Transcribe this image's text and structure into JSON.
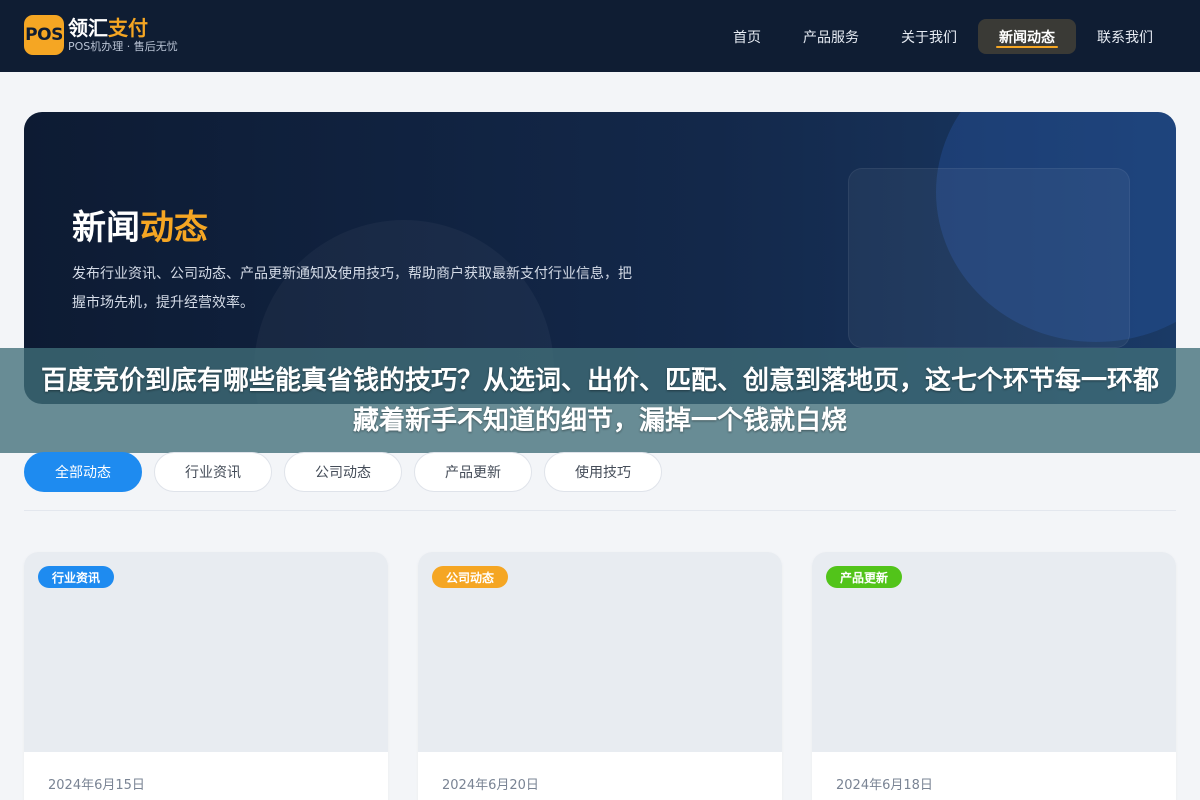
{
  "header": {
    "logo_badge": "POS",
    "logo_name_part1": "领汇",
    "logo_name_part2": "支付",
    "logo_sub": "POS机办理 · 售后无忧",
    "nav": [
      {
        "label": "首页",
        "active": false
      },
      {
        "label": "产品服务",
        "active": false
      },
      {
        "label": "关于我们",
        "active": false
      },
      {
        "label": "新闻动态",
        "active": true
      },
      {
        "label": "联系我们",
        "active": false
      }
    ]
  },
  "hero": {
    "title_part1": "新闻",
    "title_part2": "动态",
    "description": "发布行业资讯、公司动态、产品更新通知及使用技巧，帮助商户获取最新支付行业信息，把握市场先机，提升经营效率。"
  },
  "overlay": {
    "text": "百度竞价到底有哪些能真省钱的技巧？从选词、出价、匹配、创意到落地页，这七个环节每一环都藏着新手不知道的细节，漏掉一个钱就白烧"
  },
  "tabs": [
    {
      "label": "全部动态",
      "active": true
    },
    {
      "label": "行业资讯",
      "active": false
    },
    {
      "label": "公司动态",
      "active": false
    },
    {
      "label": "产品更新",
      "active": false
    },
    {
      "label": "使用技巧",
      "active": false
    }
  ],
  "cards": [
    {
      "badge": "行业资讯",
      "badge_color": "#1e8bf0",
      "date": "2024年6月15日"
    },
    {
      "badge": "公司动态",
      "badge_color": "#f5a623",
      "date": "2024年6月20日"
    },
    {
      "badge": "产品更新",
      "badge_color": "#52c41a",
      "date": "2024年6月18日"
    }
  ],
  "colors": {
    "accent": "#f5a623",
    "primary": "#1e8bf0",
    "header_bg": "#0f1d33"
  }
}
